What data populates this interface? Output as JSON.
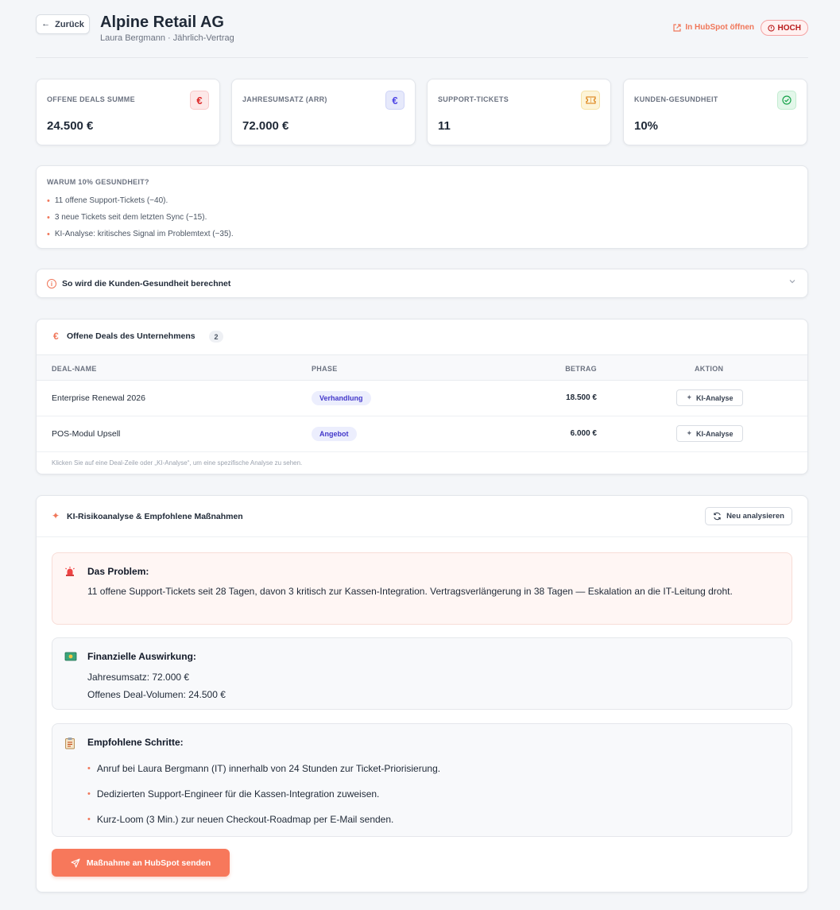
{
  "header": {
    "back_label": "Zurück",
    "company": "Alpine Retail AG",
    "subtitle": "Laura Bergmann · Jährlich-Vertrag",
    "hubspot_link": "In HubSpot öffnen",
    "priority_badge": "HOCH"
  },
  "kpis": [
    {
      "label": "OFFENE DEALS SUMME",
      "value": "24.500 €",
      "icon": "euro-icon",
      "glyph": "€",
      "color": "#dc2626"
    },
    {
      "label": "JAHRESUMSATZ (ARR)",
      "value": "72.000 €",
      "icon": "euro-icon",
      "glyph": "€",
      "color": "#4f46e5"
    },
    {
      "label": "SUPPORT-TICKETS",
      "value": "11",
      "icon": "ticket-icon",
      "glyph": "⊟",
      "color": "#d97706"
    },
    {
      "label": "KUNDEN-GESUNDHEIT",
      "value": "10%",
      "icon": "check-circle-icon",
      "glyph": "✓",
      "color": "#16a34a"
    }
  ],
  "why": {
    "title": "WARUM 10% GESUNDHEIT?",
    "items": [
      "11 offene Support-Tickets (−40).",
      "3 neue Tickets seit dem letzten Sync (−15).",
      "KI-Analyse: kritisches Signal im Problemtext (−35)."
    ]
  },
  "health_info": {
    "label": "So wird die Kunden-Gesundheit berechnet"
  },
  "deals": {
    "title": "Offene Deals des Unternehmens",
    "count": "2",
    "columns": [
      "DEAL-NAME",
      "PHASE",
      "BETRAG",
      "AKTION"
    ],
    "rows": [
      {
        "name": "Enterprise Renewal 2026",
        "phase": "Verhandlung",
        "amount": "18.500 €",
        "action": "KI-Analyse"
      },
      {
        "name": "POS-Modul Upsell",
        "phase": "Angebot",
        "amount": "6.000 €",
        "action": "KI-Analyse"
      }
    ],
    "hint": "Klicken Sie auf eine Deal-Zeile oder „KI-Analyse“, um eine spezifische Analyse zu sehen."
  },
  "analysis": {
    "title": "KI-Risikoanalyse & Empfohlene Maßnahmen",
    "reanalyze_label": "Neu analysieren",
    "problem": {
      "title": "Das Problem:",
      "text": "11 offene Support-Tickets seit 28 Tagen, davon 3 kritisch zur Kassen-Integration. Vertragsverlängerung in 38 Tagen — Eskalation an die IT-Leitung droht."
    },
    "finance": {
      "title": "Finanzielle Auswirkung:",
      "lines": [
        "Jahresumsatz: 72.000 €",
        "Offenes Deal-Volumen: 24.500 €"
      ]
    },
    "steps": {
      "title": "Empfohlene Schritte:",
      "items": [
        "Anruf bei Laura Bergmann (IT) innerhalb von 24 Stunden zur Ticket-Priorisierung.",
        "Dedizierten Support-Engineer für die Kassen-Integration zuweisen.",
        "Kurz-Loom (3 Min.) zur neuen Checkout-Roadmap per E-Mail senden."
      ]
    },
    "send_label": "Maßnahme an HubSpot senden"
  },
  "colors": {
    "accent": "#f7785b",
    "phase_pill": "#4338ca",
    "priority": "#b91c1c"
  }
}
